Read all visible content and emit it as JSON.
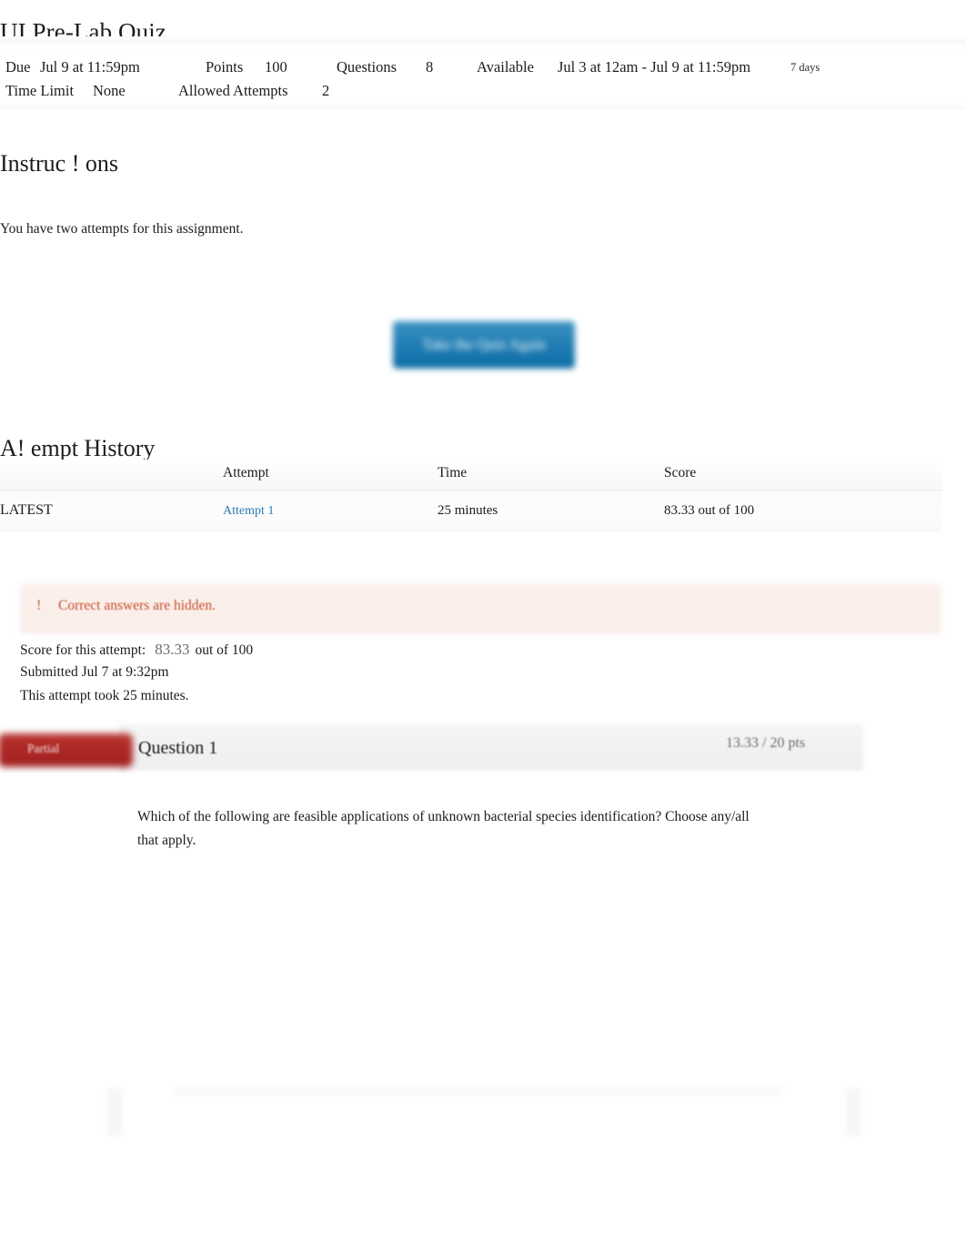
{
  "quiz": {
    "title": "UI Pre-Lab Quiz"
  },
  "meta": {
    "due_label": "Due",
    "due_value": "Jul 9 at 11:59pm",
    "points_label": "Points",
    "points_value": "100",
    "questions_label": "Questions",
    "questions_value": "8",
    "available_label": "Available",
    "available_value": "Jul 3 at 12am - Jul 9 at 11:59pm",
    "available_duration": "7 days",
    "time_limit_label": "Time Limit",
    "time_limit_value": "None",
    "allowed_attempts_label": "Allowed Attempts",
    "allowed_attempts_value": "2"
  },
  "instructions": {
    "heading": "Instruc ! ons",
    "body": "You have two attempts for this assignment."
  },
  "actions": {
    "take_quiz_again": "Take the Quiz Again"
  },
  "attempt_history": {
    "heading": "A! empt History",
    "columns": [
      "",
      "Attempt",
      "Time",
      "Score"
    ],
    "rows": [
      {
        "kind": "LATEST",
        "attempt": "Attempt 1",
        "time": "25 minutes",
        "score": "83.33 out of 100"
      }
    ]
  },
  "alert": {
    "icon": "!",
    "message": "Correct answers are hidden."
  },
  "attempt_summary": {
    "score_label": "Score for this attempt:",
    "score_value": "83.33",
    "score_suffix": "out of 100",
    "submitted": "Submitted Jul 7 at 9:32pm",
    "duration": "This attempt took 25 minutes."
  },
  "question": {
    "status_badge": "Partial",
    "title": "Question 1",
    "points": "13.33 / 20 pts",
    "text": "Which of the following are feasible applications of unknown bacterial species identification? Choose any/all that apply."
  },
  "colors": {
    "link_blue": "#2a7ab0",
    "button_blue": "#1d7cb0",
    "alert_text": "#c8502b",
    "alert_bg": "#faeee9",
    "badge_red": "#ab2725",
    "muted_text": "#6d6d6d"
  }
}
